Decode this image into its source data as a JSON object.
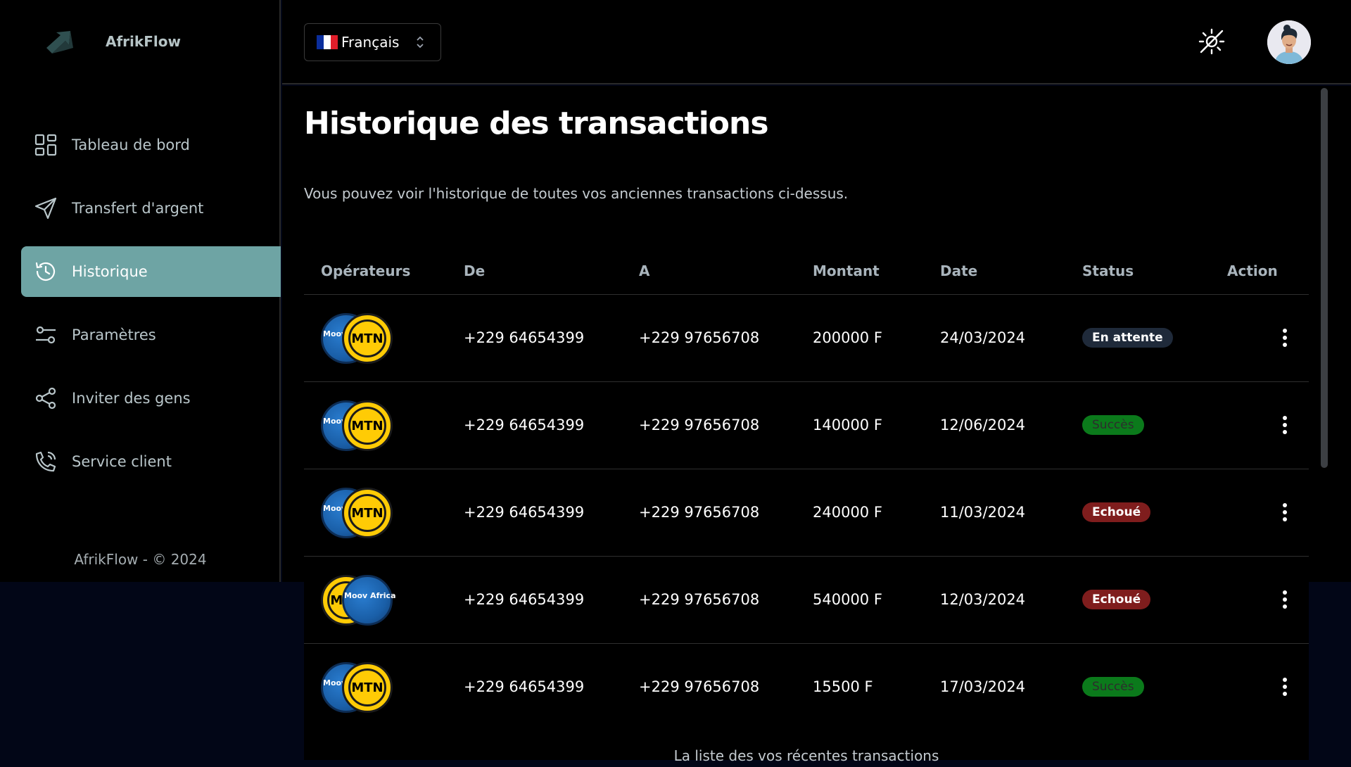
{
  "app": {
    "name": "AfrikFlow"
  },
  "sidebar": {
    "items": [
      {
        "label": "Tableau de bord",
        "icon": "dashboard-icon",
        "active": false
      },
      {
        "label": "Transfert d'argent",
        "icon": "send-icon",
        "active": false
      },
      {
        "label": "Historique",
        "icon": "history-icon",
        "active": true
      },
      {
        "label": "Paramètres",
        "icon": "settings-sliders-icon",
        "active": false
      },
      {
        "label": "Inviter des gens",
        "icon": "share-icon",
        "active": false
      },
      {
        "label": "Service client",
        "icon": "phone-icon",
        "active": false
      }
    ],
    "footer": "AfrikFlow - © 2024"
  },
  "header": {
    "language": {
      "label": "Français",
      "flag": "fr-flag-icon"
    },
    "theme_toggle": "theme-toggle-icon",
    "avatar": "user-avatar"
  },
  "page": {
    "title": "Historique des transactions",
    "subtitle": "Vous pouvez voir l'historique de toutes vos anciennes transactions ci-dessus.",
    "caption": "La liste des vos récentes transactions"
  },
  "table": {
    "columns": [
      "Opérateurs",
      "De",
      "A",
      "Montant",
      "Date",
      "Status",
      "Action"
    ],
    "rows": [
      {
        "ops_back": "moov",
        "ops_front": "mtn",
        "from": "+229 64654399",
        "to": "+229 97656708",
        "amount": "200000 F",
        "date": "24/03/2024",
        "status": "En attente",
        "status_type": "pending"
      },
      {
        "ops_back": "moov",
        "ops_front": "mtn",
        "from": "+229 64654399",
        "to": "+229 97656708",
        "amount": "140000 F",
        "date": "12/06/2024",
        "status": "Succès",
        "status_type": "success"
      },
      {
        "ops_back": "moov",
        "ops_front": "mtn",
        "from": "+229 64654399",
        "to": "+229 97656708",
        "amount": "240000 F",
        "date": "11/03/2024",
        "status": "Echoué",
        "status_type": "failed"
      },
      {
        "ops_back": "mtn",
        "ops_front": "moov",
        "from": "+229 64654399",
        "to": "+229 97656708",
        "amount": "540000 F",
        "date": "12/03/2024",
        "status": "Echoué",
        "status_type": "failed"
      },
      {
        "ops_back": "moov",
        "ops_front": "mtn",
        "from": "+229 64654399",
        "to": "+229 97656708",
        "amount": "15500 F",
        "date": "17/03/2024",
        "status": "Succès",
        "status_type": "success"
      }
    ]
  },
  "operators": {
    "mtn": {
      "label": "MTN"
    },
    "moov": {
      "label": "Moov Africa"
    }
  },
  "colors": {
    "accent": "#6ea4a4",
    "pending": "#1f2a3a",
    "success": "#0b7a1b",
    "failed": "#7f1d1d"
  }
}
